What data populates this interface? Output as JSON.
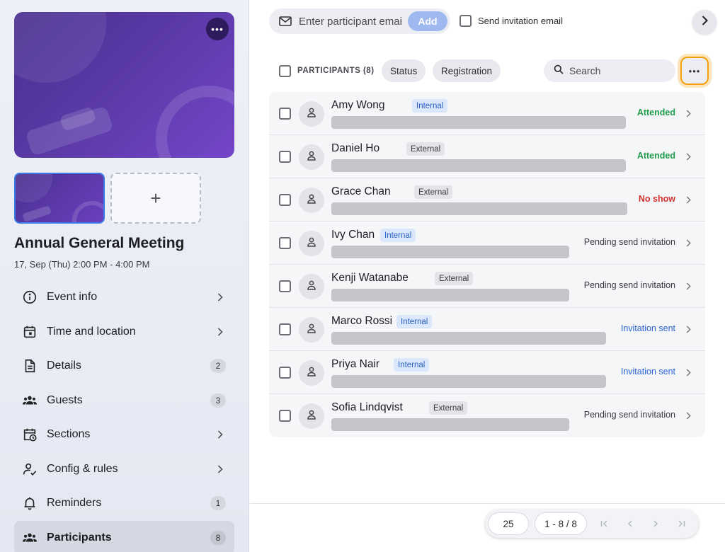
{
  "sidebar": {
    "cover_menu_icon": "more-horizontal-icon",
    "add_image_glyph": "+",
    "event_title": "Annual General Meeting",
    "event_date": "17, Sep (Thu) 2:00 PM - 4:00 PM",
    "nav": [
      {
        "label": "Event info",
        "icon": "info-icon",
        "badge": null
      },
      {
        "label": "Time and location",
        "icon": "calendar-icon",
        "badge": null
      },
      {
        "label": "Details",
        "icon": "document-icon",
        "badge": "2"
      },
      {
        "label": "Guests",
        "icon": "group-icon",
        "badge": "3"
      },
      {
        "label": "Sections",
        "icon": "calendar-clock-icon",
        "badge": null
      },
      {
        "label": "Config & rules",
        "icon": "user-check-icon",
        "badge": null
      },
      {
        "label": "Reminders",
        "icon": "bell-icon",
        "badge": "1"
      },
      {
        "label": "Participants",
        "icon": "group-icon",
        "badge": "8",
        "active": true
      }
    ]
  },
  "invite": {
    "placeholder": "Enter participant email",
    "add_label": "Add",
    "send_invitation_label": "Send invitation email"
  },
  "toolbar": {
    "participants_label": "PARTICIPANTS (8)",
    "status_chip": "Status",
    "registration_chip": "Registration",
    "search_placeholder": "Search"
  },
  "participants": [
    {
      "name": "Amy Wong",
      "type": "Internal",
      "status": "Attended",
      "status_kind": "attended"
    },
    {
      "name": "Daniel Ho",
      "type": "External",
      "status": "Attended",
      "status_kind": "attended"
    },
    {
      "name": "Grace Chan",
      "type": "External",
      "status": "No show",
      "status_kind": "noshow"
    },
    {
      "name": "Ivy Chan",
      "type": "Internal",
      "status": "Pending send invitation",
      "status_kind": "pending"
    },
    {
      "name": "Kenji Watanabe",
      "type": "External",
      "status": "Pending send invitation",
      "status_kind": "pending"
    },
    {
      "name": "Marco Rossi",
      "type": "Internal",
      "status": "Invitation sent",
      "status_kind": "sent"
    },
    {
      "name": "Priya Nair",
      "type": "Internal",
      "status": "Invitation sent",
      "status_kind": "sent"
    },
    {
      "name": "Sofia Lindqvist",
      "type": "External",
      "status": "Pending send invitation",
      "status_kind": "pending"
    }
  ],
  "pagination": {
    "page_size": "25",
    "range": "1 - 8 / 8"
  },
  "colors": {
    "accent": "#2a63d2",
    "attended": "#1f9d4a",
    "no_show": "#d0312d",
    "focus_ring": "#f59e0b"
  }
}
